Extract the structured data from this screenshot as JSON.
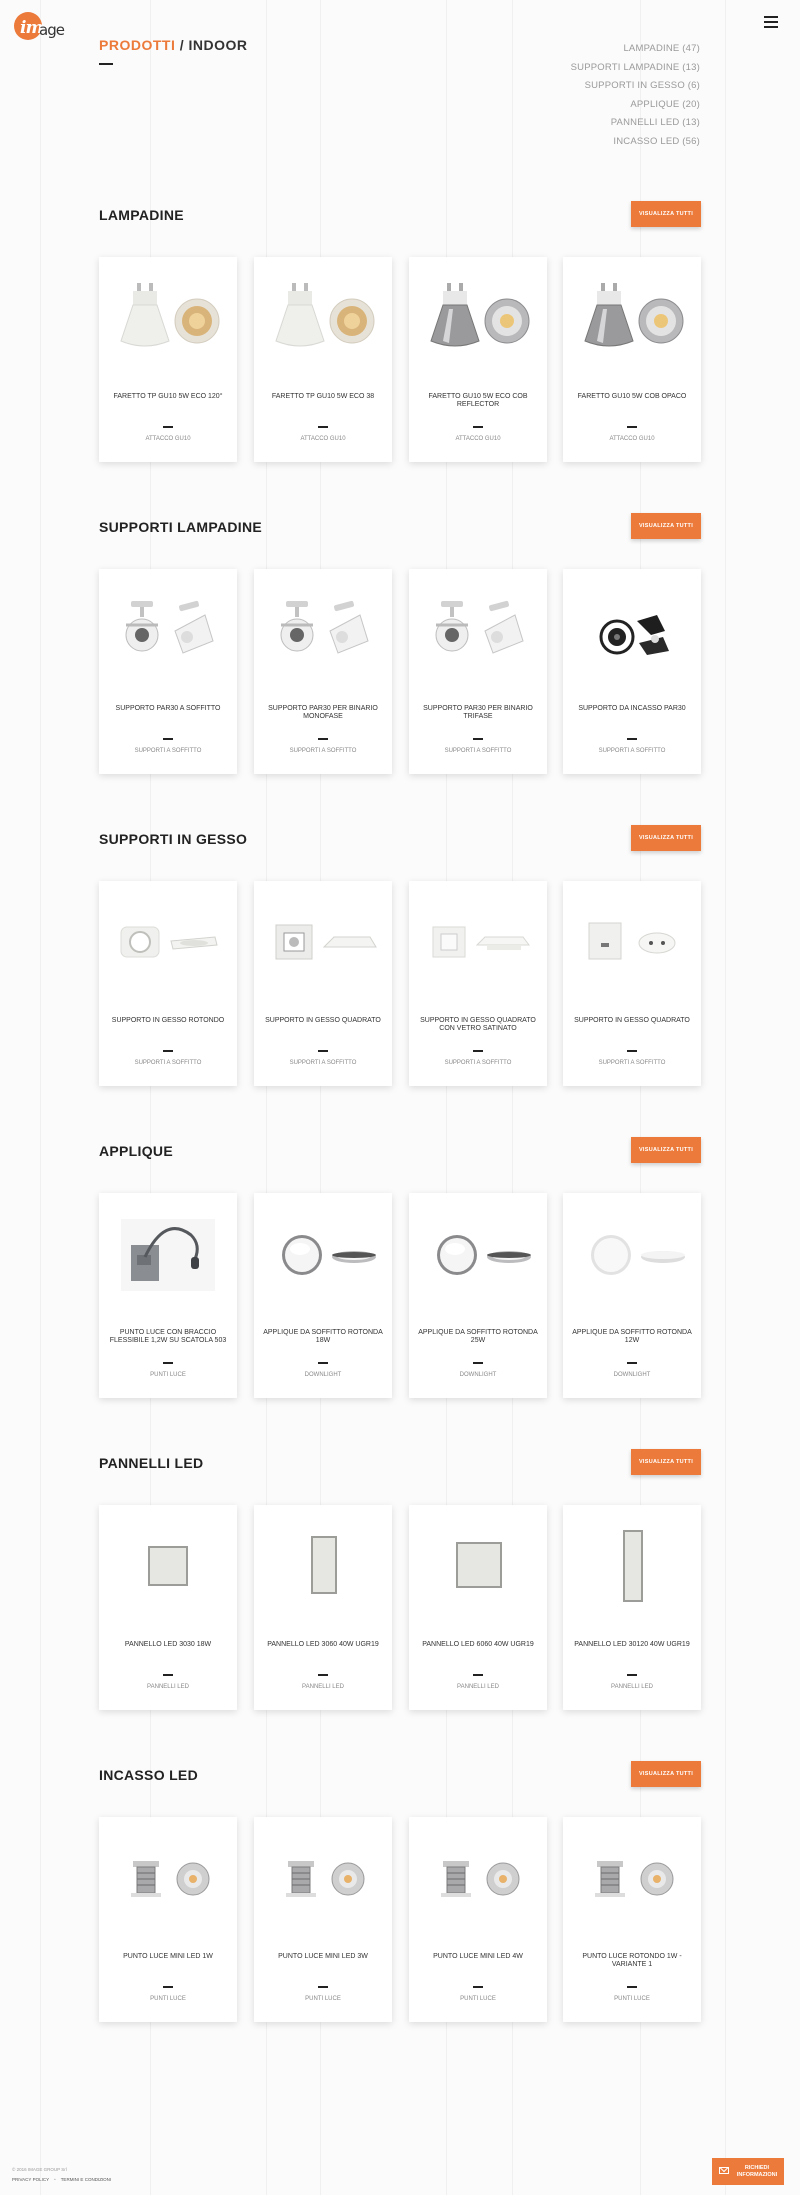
{
  "header": {
    "logo_text": "Image",
    "menu_icon": "hamburger-icon"
  },
  "page": {
    "title_primary": "PRODOTTI",
    "title_secondary": "/ INDOOR"
  },
  "categories": [
    {
      "label": "LAMPADINE (47)"
    },
    {
      "label": "SUPPORTI LAMPADINE (13)"
    },
    {
      "label": "SUPPORTI IN GESSO (6)"
    },
    {
      "label": "APPLIQUE (20)"
    },
    {
      "label": "PANNELLI LED (13)"
    },
    {
      "label": "INCASSO LED (56)"
    }
  ],
  "view_all_label": "VISUALIZZA TUTTI",
  "sections": [
    {
      "title": "LAMPADINE",
      "products": [
        {
          "name": "FARETTO TP GU10 5W ECO 120°",
          "category": "ATTACCO GU10",
          "image": "bulb-gu10-white"
        },
        {
          "name": "FARETTO TP GU10 5W ECO 38",
          "category": "ATTACCO GU10",
          "image": "bulb-gu10-white"
        },
        {
          "name": "FARETTO GU10 5W ECO COB REFLECTOR",
          "category": "ATTACCO GU10",
          "image": "bulb-gu10-chrome"
        },
        {
          "name": "FARETTO GU10 5W COB OPACO",
          "category": "ATTACCO GU10",
          "image": "bulb-gu10-chrome"
        }
      ]
    },
    {
      "title": "SUPPORTI LAMPADINE",
      "products": [
        {
          "name": "SUPPORTO PAR30 A SOFFITTO",
          "category": "SUPPORTI A SOFFITTO",
          "image": "spot-white"
        },
        {
          "name": "SUPPORTO PAR30 PER BINARIO MONOFASE",
          "category": "SUPPORTI A SOFFITTO",
          "image": "spot-white"
        },
        {
          "name": "SUPPORTO PAR30 PER BINARIO TRIFASE",
          "category": "SUPPORTI A SOFFITTO",
          "image": "spot-white"
        },
        {
          "name": "SUPPORTO DA INCASSO PAR30",
          "category": "SUPPORTI A SOFFITTO",
          "image": "spot-black"
        }
      ]
    },
    {
      "title": "SUPPORTI IN GESSO",
      "products": [
        {
          "name": "SUPPORTO IN GESSO ROTONDO",
          "category": "SUPPORTI A SOFFITTO",
          "image": "gesso-round"
        },
        {
          "name": "SUPPORTO IN GESSO QUADRATO",
          "category": "SUPPORTI A SOFFITTO",
          "image": "gesso-square"
        },
        {
          "name": "SUPPORTO IN GESSO QUADRATO CON VETRO SATINATO",
          "category": "SUPPORTI A SOFFITTO",
          "image": "gesso-square-glass"
        },
        {
          "name": "SUPPORTO IN GESSO QUADRATO",
          "category": "SUPPORTI A SOFFITTO",
          "image": "gesso-block"
        }
      ]
    },
    {
      "title": "APPLIQUE",
      "products": [
        {
          "name": "PUNTO LUCE CON BRACCIO FLESSIBILE 1,2W SU SCATOLA 503",
          "category": "PUNTI LUCE",
          "image": "flex-arm"
        },
        {
          "name": "APPLIQUE DA SOFFITTO ROTONDA 18W",
          "category": "DOWNLIGHT",
          "image": "round-ceiling"
        },
        {
          "name": "APPLIQUE DA SOFFITTO ROTONDA 25W",
          "category": "DOWNLIGHT",
          "image": "round-ceiling"
        },
        {
          "name": "APPLIQUE DA SOFFITTO ROTONDA 12W",
          "category": "DOWNLIGHT",
          "image": "round-ceiling-flat"
        }
      ]
    },
    {
      "title": "PANNELLI LED",
      "products": [
        {
          "name": "PANNELLO LED 3030 18W",
          "category": "PANNELLI LED",
          "image": "panel-square"
        },
        {
          "name": "PANNELLO LED 3060 40W UGR19",
          "category": "PANNELLI LED",
          "image": "panel-rect"
        },
        {
          "name": "PANNELLO LED 6060 40W UGR19",
          "category": "PANNELLI LED",
          "image": "panel-square-large"
        },
        {
          "name": "PANNELLO LED 30120 40W UGR19",
          "category": "PANNELLI LED",
          "image": "panel-long"
        }
      ]
    },
    {
      "title": "INCASSO LED",
      "products": [
        {
          "name": "PUNTO LUCE MINI LED 1W",
          "category": "PUNTI LUCE",
          "image": "mini-led"
        },
        {
          "name": "PUNTO LUCE MINI LED 3W",
          "category": "PUNTI LUCE",
          "image": "mini-led"
        },
        {
          "name": "PUNTO LUCE MINI LED 4W",
          "category": "PUNTI LUCE",
          "image": "mini-led"
        },
        {
          "name": "PUNTO LUCE ROTONDO 1W - VARIANTE 1",
          "category": "PUNTI LUCE",
          "image": "mini-led"
        }
      ]
    }
  ],
  "footer": {
    "copyright": "© 2016 IMAGE GROUP Srl",
    "privacy": "PRIVACY POLICY",
    "terms": "TERMINI E CONDIZIONI",
    "info_button": "RICHIEDI INFORMAZIONI"
  },
  "colors": {
    "accent": "#ec7a3a"
  }
}
